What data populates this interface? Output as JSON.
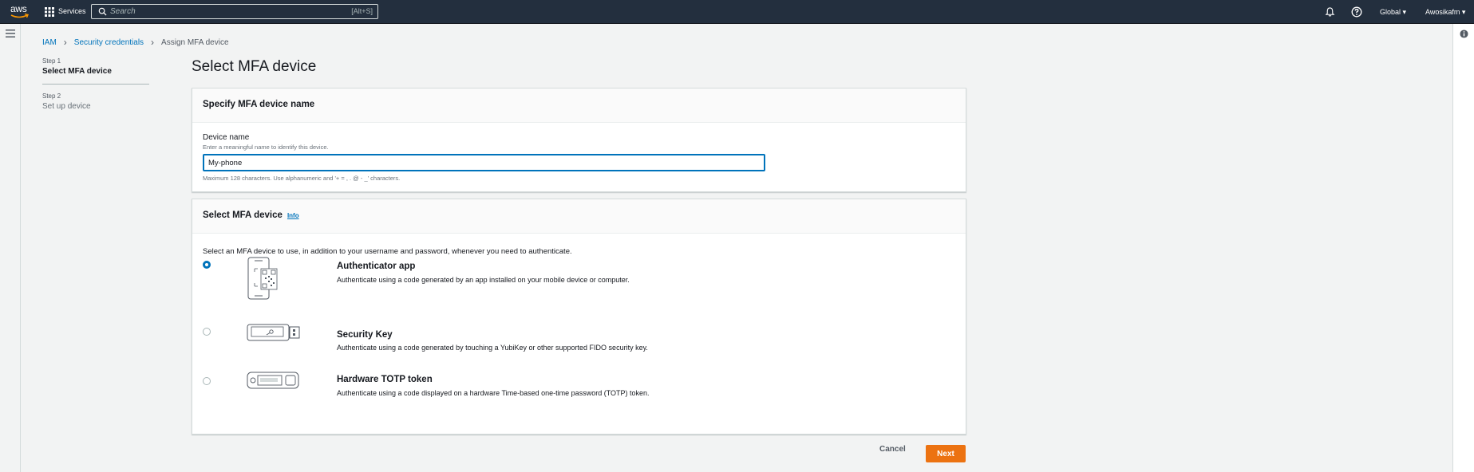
{
  "topnav": {
    "logo_text": "aws",
    "services_label": "Services",
    "search_placeholder": "Search",
    "search_shortcut": "[Alt+S]",
    "region": "Global ▾",
    "account": "Awosikafm ▾"
  },
  "breadcrumb": {
    "items": [
      "IAM",
      "Security credentials"
    ],
    "current": "Assign MFA device"
  },
  "steps": [
    {
      "num": "Step 1",
      "label": "Select MFA device",
      "active": true
    },
    {
      "num": "Step 2",
      "label": "Set up device",
      "active": false
    }
  ],
  "page_title": "Select MFA device",
  "name_panel": {
    "heading": "Specify MFA device name",
    "field_label": "Device name",
    "field_desc": "Enter a meaningful name to identify this device.",
    "field_value": "My-phone",
    "field_constraint": "Maximum 128 characters. Use alphanumeric and '+ = , . @ - _' characters."
  },
  "device_panel": {
    "heading": "Select MFA device",
    "info_link": "Info",
    "description": "Select an MFA device to use, in addition to your username and password, whenever you need to authenticate.",
    "options": [
      {
        "title": "Authenticator app",
        "desc": "Authenticate using a code generated by an app installed on your mobile device or computer.",
        "selected": true
      },
      {
        "title": "Security Key",
        "desc": "Authenticate using a code generated by touching a YubiKey or other supported FIDO security key.",
        "selected": false
      },
      {
        "title": "Hardware TOTP token",
        "desc": "Authenticate using a code displayed on a hardware Time-based one-time password (TOTP) token.",
        "selected": false
      }
    ]
  },
  "actions": {
    "cancel": "Cancel",
    "next": "Next"
  },
  "colors": {
    "nav_bg": "#232f3e",
    "link": "#0073bb",
    "primary_button": "#ec7211"
  }
}
